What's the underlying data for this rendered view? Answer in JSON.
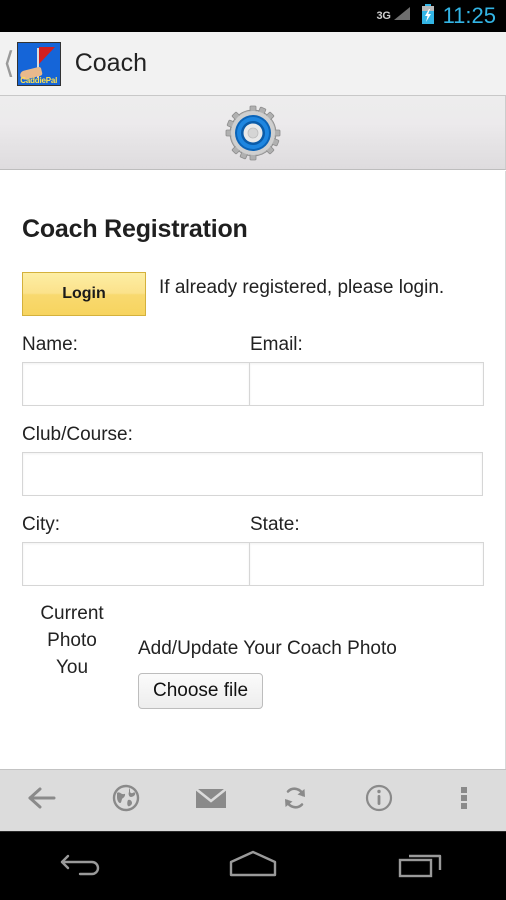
{
  "status_bar": {
    "network": "3G",
    "clock": "11:25",
    "signal_icon": "signal-bars-icon",
    "battery_icon": "battery-charging-icon",
    "clock_color": "#33b5e5"
  },
  "title_bar": {
    "back_icon": "back-chevron-icon",
    "app_icon": "caddiepal-app-icon",
    "app_icon_label": "CaddiePal",
    "title": "Coach"
  },
  "banner": {
    "icon": "gear-icon"
  },
  "page": {
    "heading": "Coach Registration",
    "login_button": "Login",
    "login_note": "If already registered, please login.",
    "fields": {
      "name": {
        "label": "Name:",
        "value": "",
        "placeholder": ""
      },
      "email": {
        "label": "Email:",
        "value": "",
        "placeholder": ""
      },
      "club_course": {
        "label": "Club/Course:",
        "value": "",
        "placeholder": ""
      },
      "city": {
        "label": "City:",
        "value": "",
        "placeholder": ""
      },
      "state": {
        "label": "State:",
        "value": "",
        "placeholder": ""
      }
    },
    "photo": {
      "current_photo_line1": "Current",
      "current_photo_line2": "Photo",
      "current_photo_line3": "You",
      "caption": "Add/Update Your Coach Photo",
      "choose_file_button": "Choose file"
    }
  },
  "toolbar": {
    "items": [
      {
        "name": "back-arrow-icon",
        "label": "Back"
      },
      {
        "name": "globe-icon",
        "label": "Browser"
      },
      {
        "name": "envelope-icon",
        "label": "Mail"
      },
      {
        "name": "refresh-icon",
        "label": "Refresh"
      },
      {
        "name": "info-icon",
        "label": "Info"
      },
      {
        "name": "overflow-menu-icon",
        "label": "More"
      }
    ]
  },
  "nav_bar": {
    "items": [
      {
        "name": "android-back-icon",
        "label": "Back"
      },
      {
        "name": "android-home-icon",
        "label": "Home"
      },
      {
        "name": "android-recents-icon",
        "label": "Recents"
      }
    ]
  },
  "colors": {
    "accent_blue": "#33b5e5",
    "button_yellow": "#f8d96f",
    "app_icon_blue": "#1565d8",
    "flag_red": "#d21f1f"
  }
}
